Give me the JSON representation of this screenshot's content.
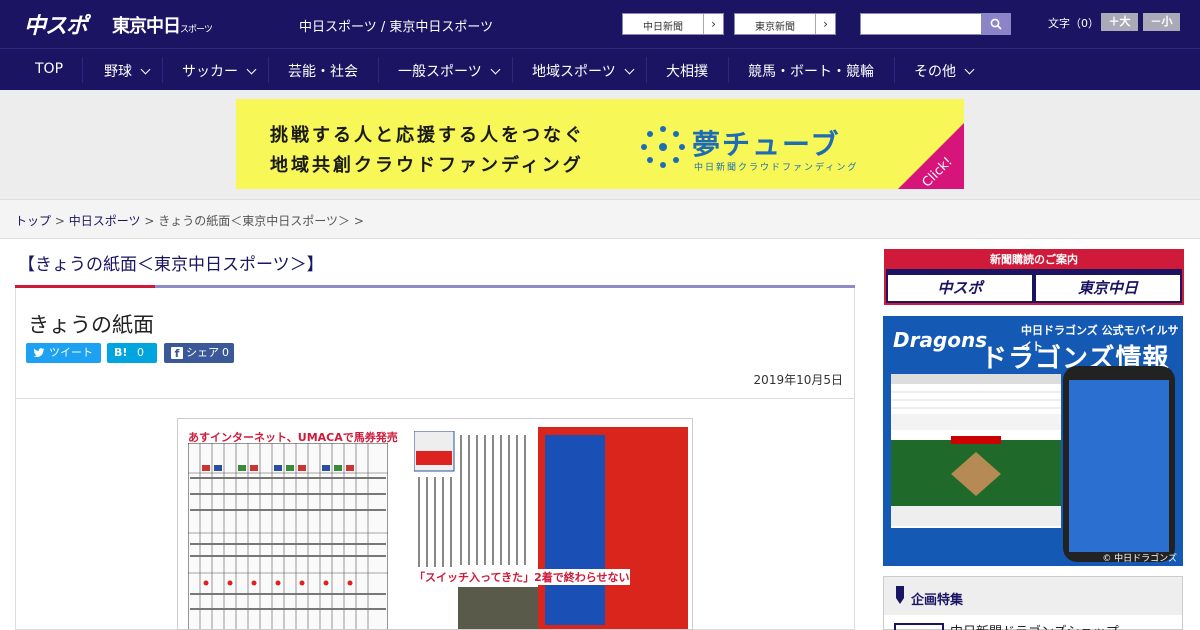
{
  "header": {
    "logo_main": "中スポ",
    "logo_tokyo": "東京中日",
    "logo_tokyo_small": "スポーツ",
    "site_title": "中日スポーツ / 東京中日スポーツ",
    "paper_buttons": [
      {
        "label": "中日新聞"
      },
      {
        "label": "東京新聞"
      }
    ],
    "search_placeholder": "",
    "fontsize_label": "文字（0）",
    "fontsize_up": "＋大",
    "fontsize_down": "－小"
  },
  "nav": {
    "items": [
      {
        "label": "TOP",
        "has_dropdown": false
      },
      {
        "label": "野球",
        "has_dropdown": true
      },
      {
        "label": "サッカー",
        "has_dropdown": true
      },
      {
        "label": "芸能・社会",
        "has_dropdown": false
      },
      {
        "label": "一般スポーツ",
        "has_dropdown": true
      },
      {
        "label": "地域スポーツ",
        "has_dropdown": true
      },
      {
        "label": "大相撲",
        "has_dropdown": false
      },
      {
        "label": "競馬・ボート・競輪",
        "has_dropdown": false
      },
      {
        "label": "その他",
        "has_dropdown": true
      }
    ]
  },
  "banner": {
    "line1": "挑戦する人と応援する人をつなぐ",
    "line2": "地域共創クラウドファンディング",
    "brand": "夢チューブ",
    "brand_sub": "中日新聞クラウドファンディング",
    "click": "Click!",
    "colors": {
      "bg": "#f7f757",
      "brand": "#1d6cb4",
      "corner": "#d6147a"
    }
  },
  "breadcrumb": {
    "items": [
      "トップ",
      "中日スポーツ",
      "きょうの紙面＜東京中日スポーツ＞"
    ],
    "separator": ">"
  },
  "main": {
    "page_heading": "【きょうの紙面＜東京中日スポーツ＞】",
    "article_title": "きょうの紙面",
    "share": {
      "tweet_icon": "twitter-icon",
      "tweet_label": "ツイート",
      "hatena_icon": "B!",
      "hatena_count": "0",
      "facebook_icon": "f",
      "facebook_label": "シェア",
      "facebook_count": "0"
    },
    "date": "2019年10月5日",
    "newspaper": {
      "headline_top": "あすインターネット、UMACAで馬券発売",
      "caption": "「スイッチ入ってきた」2着で終わらせない"
    }
  },
  "sidebar": {
    "subscribe_title": "新聞購読のご案内",
    "subscribe_buttons": [
      "中スポ",
      "東京中日"
    ],
    "dragons": {
      "logo": "Dragons",
      "sub": "中日ドラゴンズ 公式モバイルサイト",
      "title": "ドラゴンズ情報",
      "copyright": "© 中日ドラゴンズ"
    },
    "special": {
      "title": "企画特集",
      "item": "中日新聞ドラゴンズショップ"
    }
  },
  "colors": {
    "header_bg": "#1a1462",
    "accent_red": "#d01a3a",
    "accent_purple": "#8e8bc6"
  }
}
